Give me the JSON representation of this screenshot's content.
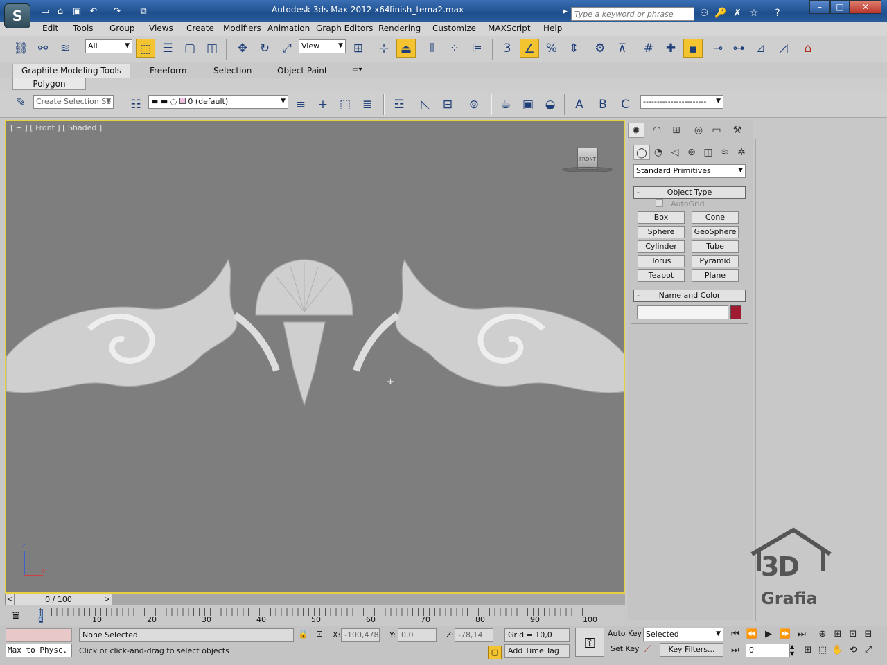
{
  "window": {
    "app_title": "Autodesk 3ds Max  2012 x64",
    "file_title": "finish_tema2.max",
    "logo": "S",
    "minimize": "–",
    "maximize": "□",
    "close": "✕"
  },
  "search": {
    "placeholder": "Type a keyword or phrase"
  },
  "menu": [
    "Edit",
    "Tools",
    "Group",
    "Views",
    "Create",
    "Modifiers",
    "Animation",
    "Graph Editors",
    "Rendering",
    "Customize",
    "MAXScript",
    "Help"
  ],
  "main_toolbar": {
    "selection_filter": "All",
    "ref_coord": "View",
    "angle_snap": "3"
  },
  "ribbon": {
    "tabs": [
      "Graphite Modeling Tools",
      "Freeform",
      "Selection",
      "Object Paint"
    ],
    "active_tab": "Graphite Modeling Tools",
    "panel": "Polygon Modeling"
  },
  "layer_toolbar": {
    "named_selection": "Create Selection Se",
    "layer": "0 (default)"
  },
  "viewport": {
    "label": "[ + ] [ Front ] [ Shaded ]",
    "viewcube": "FRONT",
    "axis_z": "z",
    "axis_x": "x"
  },
  "command_panel": {
    "category": "Standard Primitives",
    "object_type_title": "Object Type",
    "autogrid": "AutoGrid",
    "buttons": [
      "Box",
      "Cone",
      "Sphere",
      "GeoSphere",
      "Cylinder",
      "Tube",
      "Torus",
      "Pyramid",
      "Teapot",
      "Plane"
    ],
    "name_color_title": "Name and Color",
    "name_value": "",
    "object_color": "#9e1b32"
  },
  "timeline": {
    "frame": "0 / 100",
    "ticks": [
      "0",
      "10",
      "20",
      "30",
      "40",
      "50",
      "60",
      "70",
      "80",
      "90",
      "100"
    ]
  },
  "status": {
    "maxscript": "Max to Physc.",
    "selection": "None Selected",
    "prompt": "Click or click-and-drag to select objects",
    "x_label": "X:",
    "x": "-100,478",
    "y_label": "Y:",
    "y": "0,0",
    "z_label": "Z:",
    "z": "-78,14",
    "grid": "Grid = 10,0",
    "add_time_tag": "Add Time Tag",
    "auto_key": "Auto Key",
    "set_key": "Set Key",
    "key_mode": "Selected",
    "key_filters": "Key Filters...",
    "current_frame": "0"
  },
  "watermark": {
    "line1": "3D",
    "line2": "Grafia"
  }
}
